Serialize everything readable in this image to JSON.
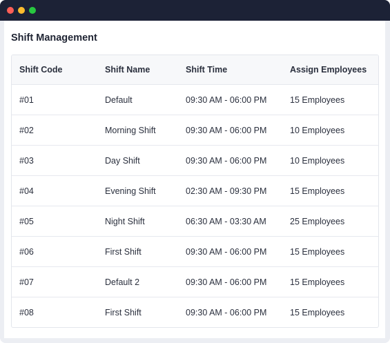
{
  "page": {
    "title": "Shift Management"
  },
  "table": {
    "columns": [
      "Shift Code",
      "Shift Name",
      "Shift Time",
      "Assign Employees"
    ],
    "rows": [
      [
        "#01",
        "Default",
        "09:30 AM - 06:00 PM",
        "15 Employees"
      ],
      [
        "#02",
        "Morning Shift",
        "09:30 AM - 06:00 PM",
        "10 Employees"
      ],
      [
        "#03",
        "Day Shift",
        "09:30 AM - 06:00 PM",
        "10 Employees"
      ],
      [
        "#04",
        "Evening Shift",
        "02:30 AM - 09:30 PM",
        "15 Employees"
      ],
      [
        "#05",
        "Night Shift",
        "06:30 AM - 03:30 AM",
        "25 Employees"
      ],
      [
        "#06",
        "First Shift",
        "09:30 AM - 06:00 PM",
        "15 Employees"
      ],
      [
        "#07",
        "Default 2",
        "09:30 AM - 06:00 PM",
        "15 Employees"
      ],
      [
        "#08",
        "First Shift",
        "09:30 AM - 06:00 PM",
        "15 Employees"
      ]
    ]
  },
  "colors": {
    "titlebar": "#1c2236",
    "close": "#ff5f57",
    "minimize": "#febc2e",
    "maximize": "#28c840"
  }
}
